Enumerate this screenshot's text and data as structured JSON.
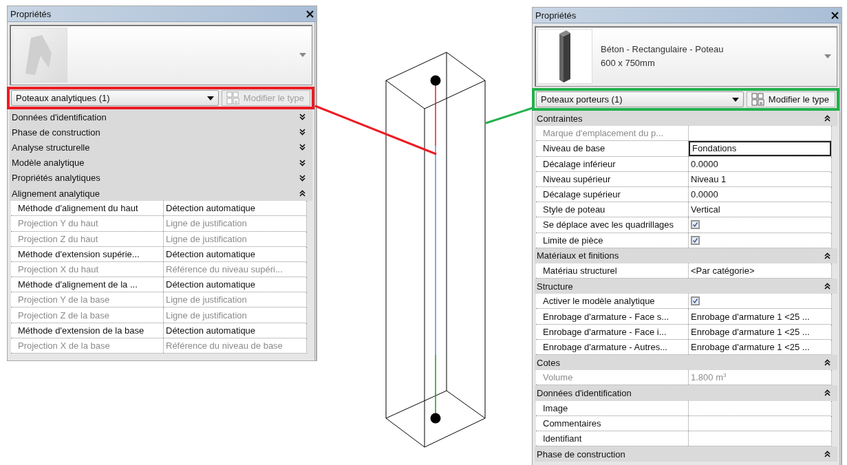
{
  "panels": [
    {
      "title": "Propriétés",
      "color": "#ec1c24",
      "preview": {
        "kind": "placeholder"
      },
      "type_selector": "Poteaux analytiques (1)",
      "edit_type": {
        "label": "Modifier le type",
        "disabled": true
      },
      "groups": [
        {
          "label": "Données d'identification",
          "expanded": false
        },
        {
          "label": "Phase de construction",
          "expanded": false
        },
        {
          "label": "Analyse structurelle",
          "expanded": false
        },
        {
          "label": "Modèle analytique",
          "expanded": false
        },
        {
          "label": "Propriétés analytiques",
          "expanded": false
        },
        {
          "label": "Alignement analytique",
          "expanded": true,
          "rows": [
            {
              "kind": "text",
              "name": "Méthode d'alignement du haut",
              "value": "Détection automatique",
              "disabled": false
            },
            {
              "kind": "text",
              "name": "Projection Y du haut",
              "value": "Ligne de justification",
              "disabled": true
            },
            {
              "kind": "text",
              "name": "Projection Z du haut",
              "value": "Ligne de justification",
              "disabled": true
            },
            {
              "kind": "text",
              "name": "Méthode d'extension supérie...",
              "value": "Détection automatique",
              "disabled": false
            },
            {
              "kind": "text",
              "name": "Projection X du haut",
              "value": "Référence du niveau supéri...",
              "disabled": true
            },
            {
              "kind": "text",
              "name": "Méthode d'alignement de la ...",
              "value": "Détection automatique",
              "disabled": false
            },
            {
              "kind": "text",
              "name": "Projection Y de la base",
              "value": "Ligne de justification",
              "disabled": true
            },
            {
              "kind": "text",
              "name": "Projection Z de la base",
              "value": "Ligne de justification",
              "disabled": true
            },
            {
              "kind": "text",
              "name": "Méthode d'extension de la base",
              "value": "Détection automatique",
              "disabled": false
            },
            {
              "kind": "text",
              "name": "Projection X de la base",
              "value": "Référence du niveau de base",
              "disabled": true
            }
          ]
        }
      ]
    },
    {
      "title": "Propriétés",
      "color": "#22b14c",
      "preview": {
        "kind": "column",
        "lines": [
          "Béton - Rectangulaire - Poteau",
          "600 x 750mm"
        ]
      },
      "type_selector": "Poteaux porteurs (1)",
      "edit_type": {
        "label": "Modifier le type",
        "disabled": false
      },
      "groups": [
        {
          "label": "Contraintes",
          "expanded": true,
          "rows": [
            {
              "kind": "text",
              "name": "Marque d'emplacement du p...",
              "value": "",
              "disabled": true,
              "focused": false
            },
            {
              "kind": "text",
              "name": "Niveau de base",
              "value": "Fondations",
              "disabled": false,
              "focused": true
            },
            {
              "kind": "text",
              "name": "Décalage inférieur",
              "value": "0.0000",
              "disabled": false,
              "focused": false
            },
            {
              "kind": "text",
              "name": "Niveau supérieur",
              "value": "Niveau 1",
              "disabled": false,
              "focused": false
            },
            {
              "kind": "text",
              "name": "Décalage supérieur",
              "value": "0.0000",
              "disabled": false,
              "focused": false
            },
            {
              "kind": "text",
              "name": "Style de poteau",
              "value": "Vertical",
              "disabled": false,
              "focused": false
            },
            {
              "kind": "checkbox",
              "name": "Se déplace avec les quadrillages",
              "checked": true,
              "disabled": false,
              "focused": false
            },
            {
              "kind": "checkbox",
              "name": "Limite de pièce",
              "checked": true,
              "disabled": false,
              "focused": false
            }
          ]
        },
        {
          "label": "Matériaux et finitions",
          "expanded": true,
          "rows": [
            {
              "kind": "text",
              "name": "Matériau structurel",
              "value": "<Par catégorie>",
              "disabled": false,
              "focused": false
            }
          ]
        },
        {
          "label": "Structure",
          "expanded": true,
          "rows": [
            {
              "kind": "checkbox",
              "name": "Activer le modèle analytique",
              "checked": true,
              "disabled": false,
              "focused": false
            },
            {
              "kind": "text",
              "name": "Enrobage d'armature - Face s...",
              "value": "Enrobage d'armature 1 <25 ...",
              "disabled": false,
              "focused": false
            },
            {
              "kind": "text",
              "name": "Enrobage d'armature - Face i...",
              "value": "Enrobage d'armature 1 <25 ...",
              "disabled": false,
              "focused": false
            },
            {
              "kind": "text",
              "name": "Enrobage d'armature - Autres...",
              "value": "Enrobage d'armature 1 <25 ...",
              "disabled": false,
              "focused": false
            }
          ]
        },
        {
          "label": "Cotes",
          "expanded": true,
          "rows": [
            {
              "kind": "text",
              "name": "Volume",
              "value": "1.800 m$^{3}$",
              "disabled": true,
              "focused": false
            }
          ]
        },
        {
          "label": "Données d'identification",
          "expanded": true,
          "rows": [
            {
              "kind": "text",
              "name": "Image",
              "value": "",
              "disabled": false,
              "focused": false
            },
            {
              "kind": "text",
              "name": "Commentaires",
              "value": "",
              "disabled": false,
              "focused": false
            },
            {
              "kind": "text",
              "name": "Identifiant",
              "value": "",
              "disabled": false,
              "focused": false
            }
          ]
        },
        {
          "label": "Phase de construction",
          "expanded": true
        }
      ]
    }
  ]
}
